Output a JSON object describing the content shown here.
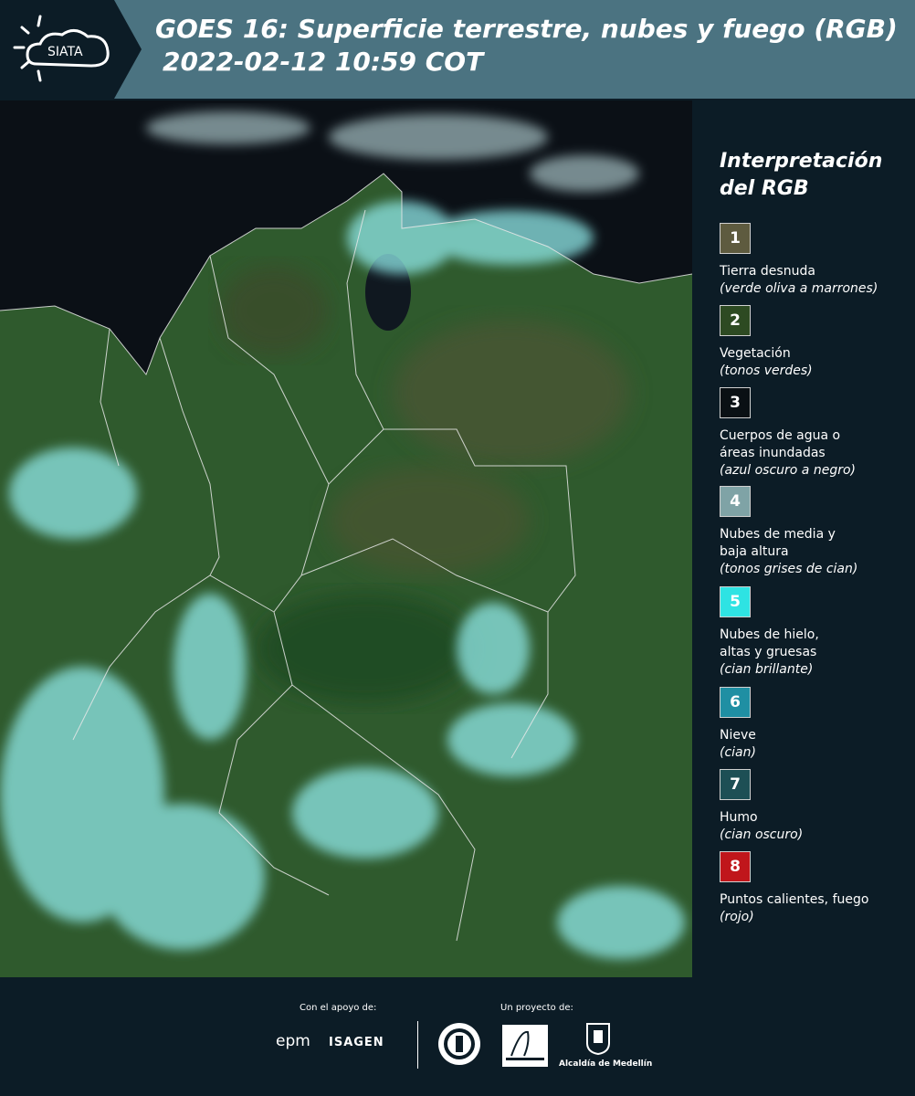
{
  "header": {
    "logo_text": "SIATA",
    "title_line1": "GOES 16: Superficie terrestre, nubes y fuego (RGB)",
    "title_line2": "2022-02-12 10:59 COT"
  },
  "legend": {
    "title_line1": "Interpretación",
    "title_line2": "del RGB",
    "items": [
      {
        "number": "1",
        "color": "#5e5b3f",
        "label": "Tierra desnuda",
        "sub": "(verde oliva a marrones)"
      },
      {
        "number": "2",
        "color": "#2d4a22",
        "label": "Vegetación",
        "sub": "(tonos verdes)"
      },
      {
        "number": "3",
        "color": "#0a1014",
        "label": "Cuerpos de agua o áreas inundadas",
        "sub": "(azul oscuro a negro)"
      },
      {
        "number": "4",
        "color": "#7fa3a6",
        "label": "Nubes de media y baja altura",
        "sub": "(tonos grises de cian)"
      },
      {
        "number": "5",
        "color": "#2ee3e3",
        "label": "Nubes de hielo, altas y gruesas",
        "sub": "(cian brillante)"
      },
      {
        "number": "6",
        "color": "#1f8fa3",
        "label": "Nieve",
        "sub": "(cian)"
      },
      {
        "number": "7",
        "color": "#1d4f55",
        "label": "Humo",
        "sub": "(cian oscuro)"
      },
      {
        "number": "8",
        "color": "#c0161b",
        "label": "Puntos calientes, fuego",
        "sub": "(rojo)"
      }
    ]
  },
  "footer": {
    "support_label": "Con el apoyo de:",
    "project_label": "Un proyecto de:",
    "sponsor1": "epm",
    "sponsor2": "ISAGEN",
    "partner1": "Área Metropolitana",
    "partner2": "Alcaldía de Medellín"
  },
  "colors": {
    "header_bg": "#4b7381",
    "logo_bg": "#0c1c26",
    "page_bg": "#0c1c26",
    "vegetation": "#2d5a2c",
    "cloud": "#8fe8e8",
    "water": "#0b1016"
  }
}
